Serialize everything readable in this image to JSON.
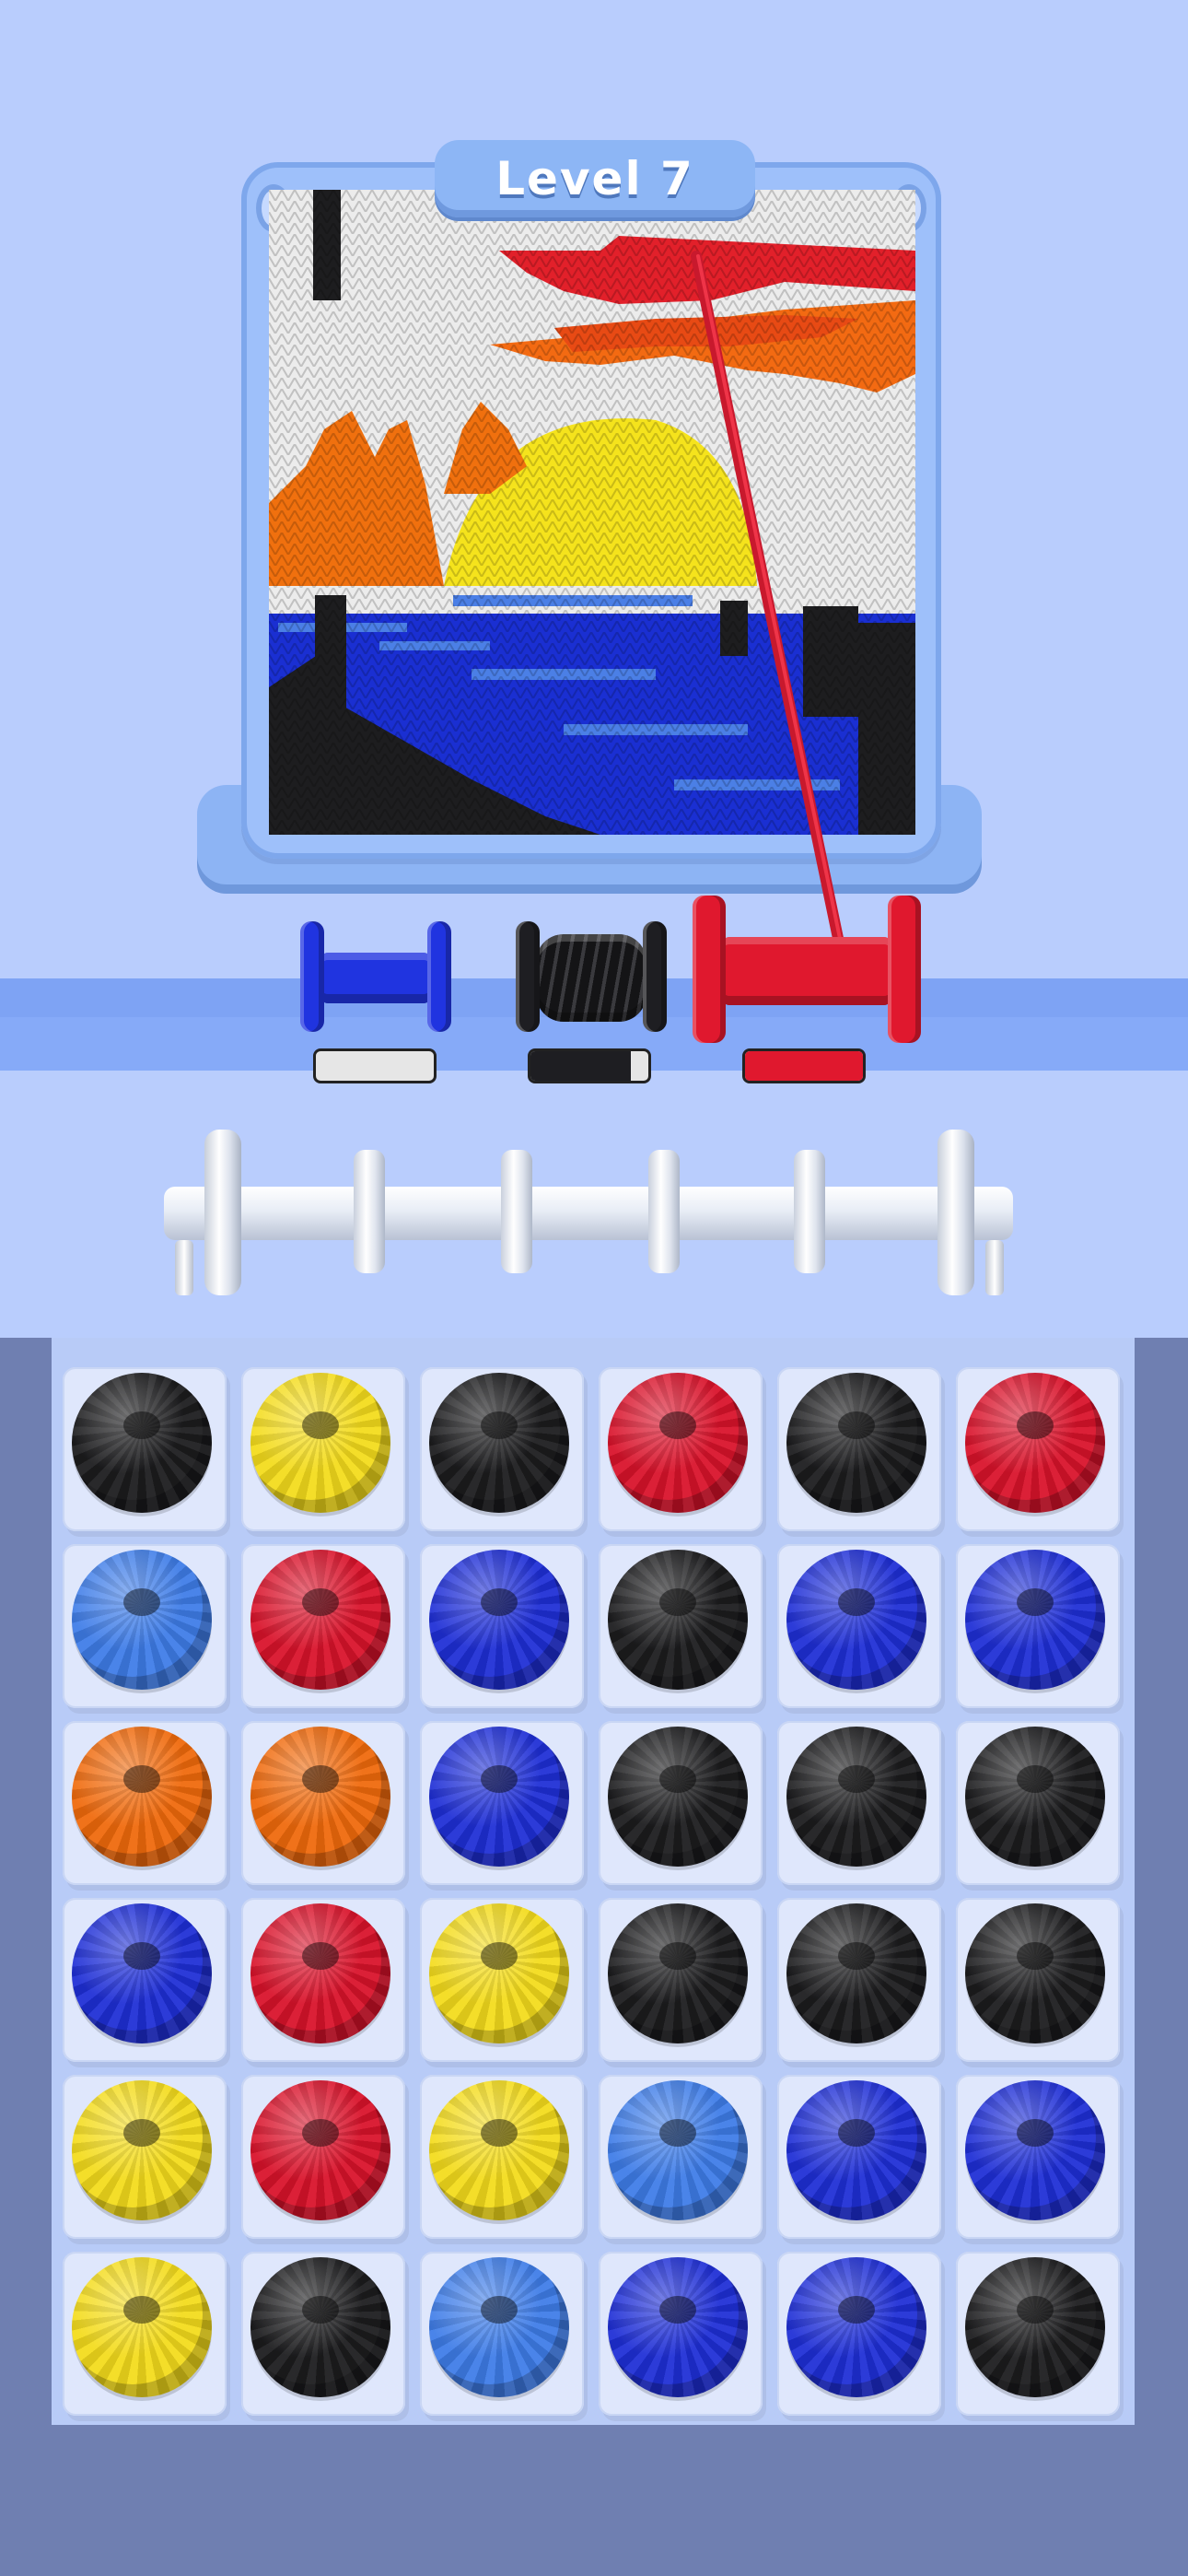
{
  "level": {
    "label": "Level 7"
  },
  "colors": {
    "black": "#1c1c1e",
    "yellow": "#f4dc1c",
    "red": "#d9132b",
    "lightblue": "#3f7de8",
    "blue": "#1f2fd6",
    "orange": "#f06a0c",
    "white": "#ececec"
  },
  "spools": [
    {
      "name": "blue-spool",
      "color": "#2034e0",
      "bar_color": "#e6e6e6",
      "bar_fill": 0.0
    },
    {
      "name": "black-spool",
      "color": "#1e1e22",
      "bar_color": "#1e1e22",
      "bar_fill": 0.85
    },
    {
      "name": "red-spool",
      "color": "#e0182e",
      "bar_color": "#e0182e",
      "bar_fill": 1.0
    }
  ],
  "rod": {
    "slots": 5
  },
  "grid": {
    "rows": [
      [
        "black",
        "yellow",
        "black",
        "red",
        "black",
        "red"
      ],
      [
        "lightblue",
        "red",
        "blue",
        "black",
        "blue",
        "blue"
      ],
      [
        "orange",
        "orange",
        "blue",
        "black",
        "black",
        "black"
      ],
      [
        "blue",
        "red",
        "yellow",
        "black",
        "black",
        "black"
      ],
      [
        "yellow",
        "red",
        "yellow",
        "lightblue",
        "blue",
        "blue"
      ],
      [
        "yellow",
        "black",
        "lightblue",
        "blue",
        "blue",
        "black"
      ]
    ]
  }
}
